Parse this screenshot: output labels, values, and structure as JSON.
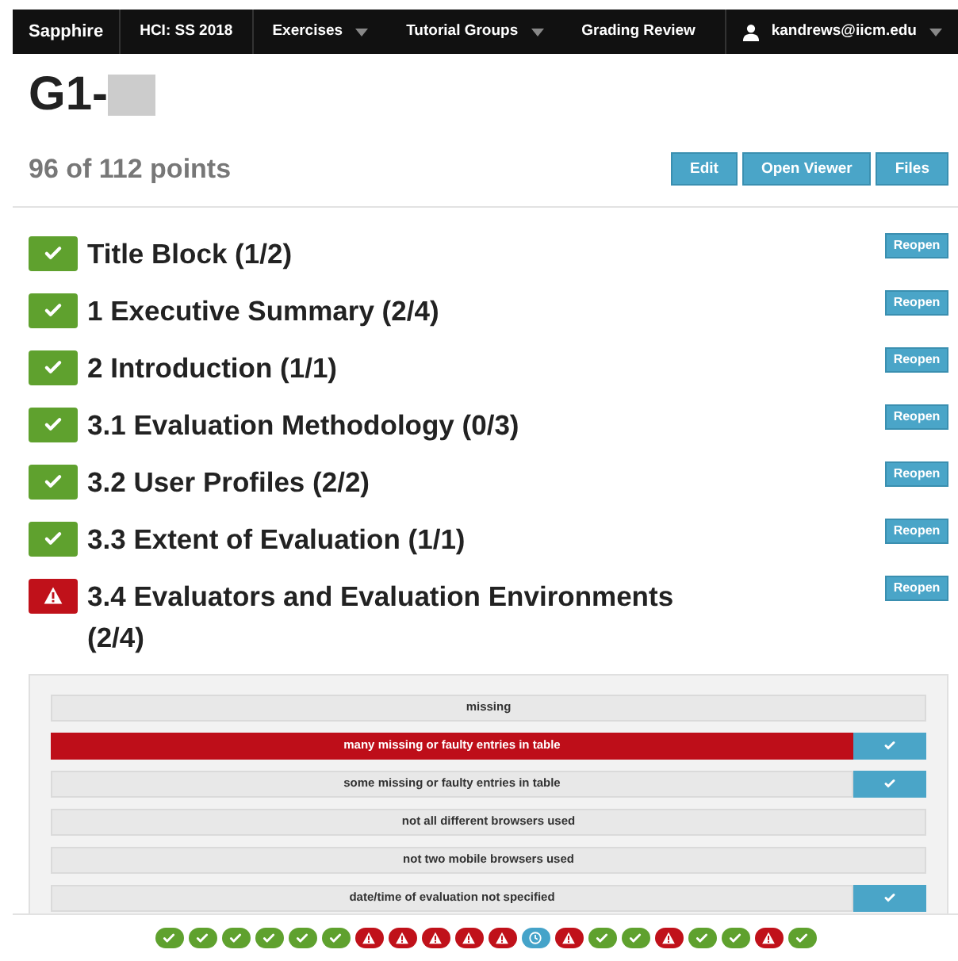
{
  "navbar": {
    "brand": "Sapphire",
    "items": [
      {
        "label": "HCI: SS 2018",
        "dropdown": false
      },
      {
        "label": "Exercises",
        "dropdown": true
      },
      {
        "label": "Tutorial Groups",
        "dropdown": true
      },
      {
        "label": "Grading Review",
        "dropdown": false
      }
    ],
    "user": {
      "label": "kandrews@iicm.edu",
      "dropdown": true
    }
  },
  "header": {
    "title": "G1-",
    "redacted": true,
    "points": "96 of 112 points",
    "buttons": [
      "Edit",
      "Open Viewer",
      "Files"
    ]
  },
  "sections": [
    {
      "title": "Title Block (1/2)",
      "kind": "ok",
      "action": "Reopen"
    },
    {
      "title": "1 Executive Summary (2/4)",
      "kind": "ok",
      "action": "Reopen"
    },
    {
      "title": "2 Introduction (1/1)",
      "kind": "ok",
      "action": "Reopen"
    },
    {
      "title": "3.1 Evaluation Methodology (0/3)",
      "kind": "ok",
      "action": "Reopen"
    },
    {
      "title": "3.2 User Profiles (2/2)",
      "kind": "ok",
      "action": "Reopen"
    },
    {
      "title": "3.3 Extent of Evaluation (1/1)",
      "kind": "ok",
      "action": "Reopen"
    },
    {
      "title": "3.4 Evaluators and Evaluation Environments (2/4)",
      "kind": "warn",
      "action": "Reopen"
    }
  ],
  "ratings": [
    {
      "label": "missing",
      "selected": false,
      "confirmed": false
    },
    {
      "label": "many missing or faulty entries in table",
      "selected": true,
      "confirmed": true
    },
    {
      "label": "some missing or faulty entries in table",
      "selected": false,
      "confirmed": true
    },
    {
      "label": "not all different browsers used",
      "selected": false,
      "confirmed": false
    },
    {
      "label": "not two mobile browsers used",
      "selected": false,
      "confirmed": false
    },
    {
      "label": "date/time of evaluation not specified",
      "selected": false,
      "confirmed": true
    }
  ],
  "progress": [
    {
      "kind": "ok"
    },
    {
      "kind": "ok"
    },
    {
      "kind": "ok"
    },
    {
      "kind": "ok"
    },
    {
      "kind": "ok"
    },
    {
      "kind": "ok"
    },
    {
      "kind": "warn"
    },
    {
      "kind": "warn"
    },
    {
      "kind": "warn"
    },
    {
      "kind": "warn"
    },
    {
      "kind": "warn"
    },
    {
      "kind": "pending"
    },
    {
      "kind": "warn"
    },
    {
      "kind": "ok"
    },
    {
      "kind": "ok"
    },
    {
      "kind": "warn"
    },
    {
      "kind": "ok"
    },
    {
      "kind": "ok"
    },
    {
      "kind": "warn"
    },
    {
      "kind": "ok"
    }
  ]
}
